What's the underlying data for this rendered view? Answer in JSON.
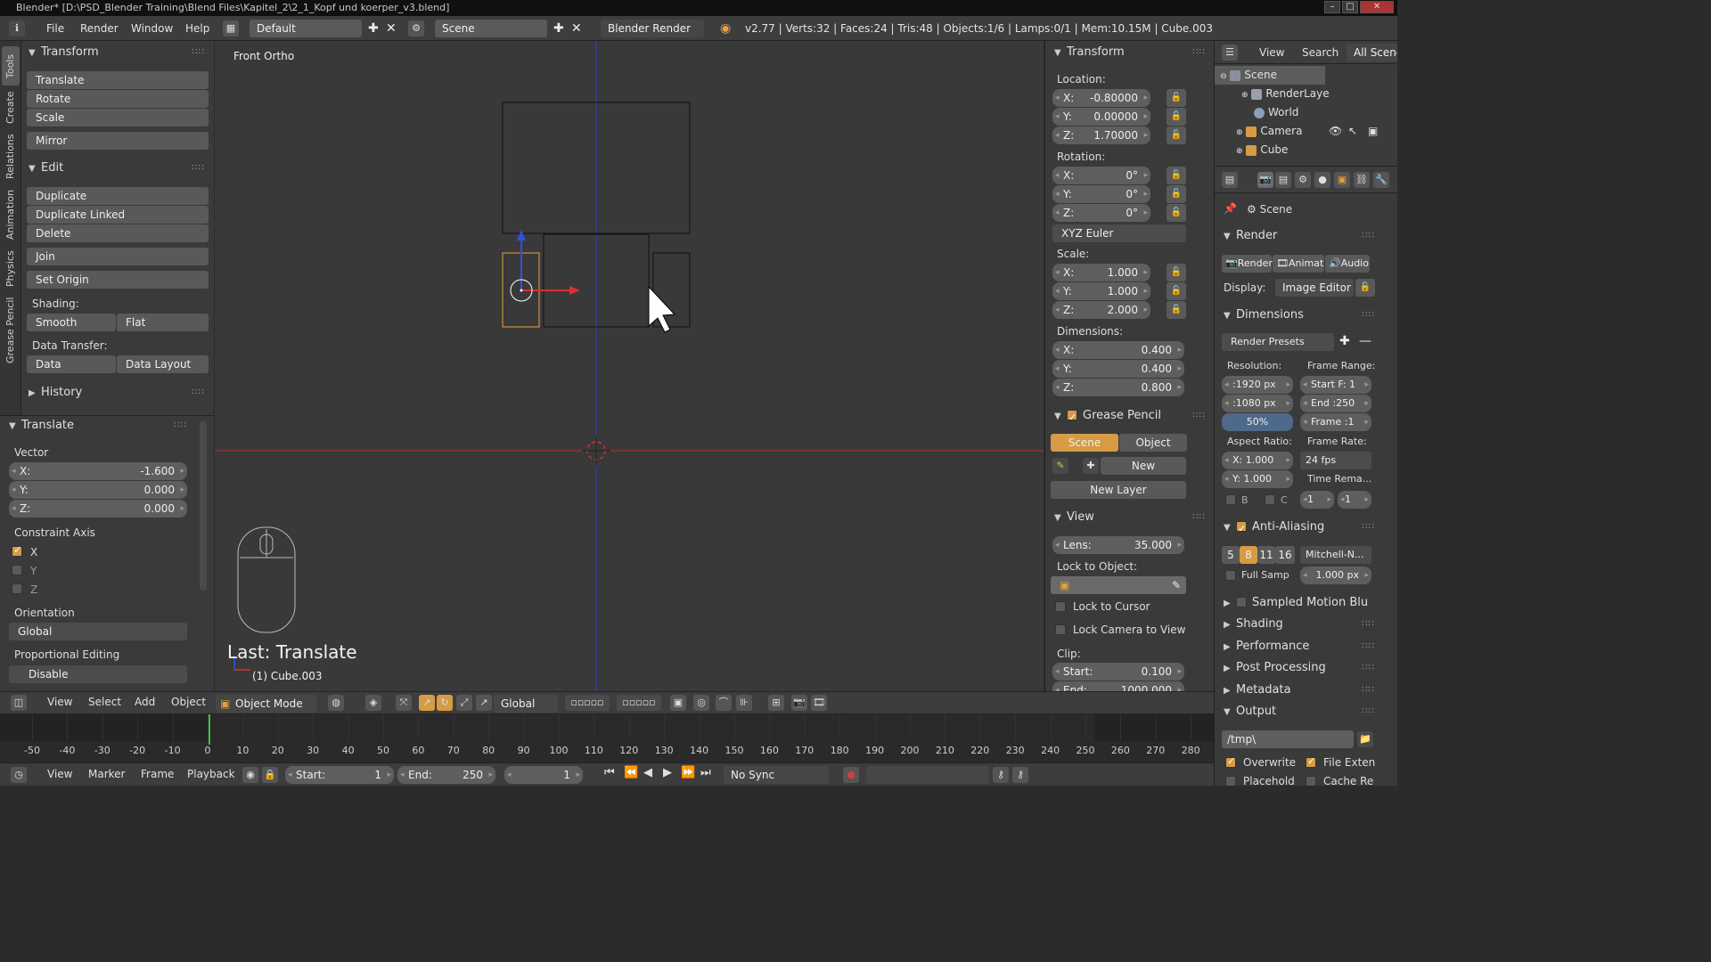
{
  "window": {
    "title": "Blender* [D:\\PSD_Blender Training\\Blend Files\\Kapitel_2\\2_1_Kopf und koerper_v3.blend]"
  },
  "topbar": {
    "menus": [
      "File",
      "Render",
      "Window",
      "Help"
    ],
    "layout": "Default",
    "scene": "Scene",
    "engine": "Blender Render",
    "stats": "v2.77 | Verts:32 | Faces:24 | Tris:48 | Objects:1/6 | Lamps:0/1 | Mem:10.15M | Cube.003"
  },
  "tabs": [
    "Tools",
    "Create",
    "Relations",
    "Animation",
    "Physics",
    "Grease Pencil"
  ],
  "toolshelf": {
    "transform": {
      "title": "Transform",
      "items": [
        "Translate",
        "Rotate",
        "Scale",
        "Mirror"
      ]
    },
    "edit": {
      "title": "Edit",
      "items": [
        "Duplicate",
        "Duplicate Linked",
        "Delete",
        "Join",
        "Set Origin"
      ]
    },
    "shading": {
      "label": "Shading:",
      "smooth": "Smooth",
      "flat": "Flat"
    },
    "datatransfer": {
      "label": "Data Transfer:",
      "data": "Data",
      "layout": "Data Layout"
    },
    "history": "History"
  },
  "operator": {
    "title": "Translate",
    "vector": "Vector",
    "x_label": "X:",
    "x": "-1.600",
    "y_label": "Y:",
    "y": "0.000",
    "z_label": "Z:",
    "z": "0.000",
    "constraint": "Constraint Axis",
    "cx": "X",
    "cy": "Y",
    "cz": "Z",
    "orientation": "Orientation",
    "orientation_value": "Global",
    "prop_edit": "Proportional Editing",
    "prop_value": "Disable"
  },
  "viewport": {
    "label": "Front Ortho",
    "last_op": "Last: Translate",
    "object": "(1) Cube.003"
  },
  "npanel": {
    "transform": "Transform",
    "location": "Location:",
    "loc": [
      "-0.80000",
      "0.00000",
      "1.70000"
    ],
    "rotation": "Rotation:",
    "rot": [
      "0°",
      "0°",
      "0°"
    ],
    "euler": "XYZ Euler",
    "scale": "Scale:",
    "scl": [
      "1.000",
      "1.000",
      "2.000"
    ],
    "dimensions": "Dimensions:",
    "dim": [
      "0.400",
      "0.400",
      "0.800"
    ],
    "axes": [
      "X:",
      "Y:",
      "Z:"
    ],
    "gp": "Grease Pencil",
    "gp_scene": "Scene",
    "gp_object": "Object",
    "gp_new": "New",
    "gp_newlayer": "New Layer",
    "view": "View",
    "lens_label": "Lens:",
    "lens": "35.000",
    "lock_obj": "Lock to Object:",
    "lock_cursor": "Lock to Cursor",
    "lock_camera": "Lock Camera to View",
    "clip": "Clip:",
    "clip_start_label": "Start:",
    "clip_start": "0.100",
    "clip_end_label": "End:",
    "clip_end": "1000.000"
  },
  "outliner": {
    "view": "View",
    "search": "Search",
    "filter": "All Scenes",
    "rows": [
      "Scene",
      "RenderLaye",
      "World",
      "Camera",
      "Cube"
    ]
  },
  "props": {
    "scene": "Scene",
    "render": "Render",
    "render_btn": "Render",
    "anim_btn": "Animat",
    "audio_btn": "Audio",
    "display_label": "Display:",
    "display": "Image Editor",
    "dimensions": "Dimensions",
    "presets": "Render Presets",
    "resolution": "Resolution:",
    "res_x": ":1920 px",
    "res_y": ":1080 px",
    "res_pct": "50%",
    "frame_range": "Frame Range:",
    "start": "Start F: 1",
    "end": "End :250",
    "frame": "Frame :1",
    "aspect": "Aspect Ratio:",
    "ax": "X:  1.000",
    "ay": "Y:  1.000",
    "frame_rate": "Frame Rate:",
    "fps": "24 fps",
    "time_rem": "Time Rema...",
    "b": "B",
    "c": "C",
    "one_a": "1",
    "one_b": "1",
    "aa": "Anti-Aliasing",
    "aa_opts": [
      "5",
      "8",
      "11",
      "16"
    ],
    "aa_filter": "Mitchell-N...",
    "full_samp": "Full Samp",
    "aa_px": "1.000 px",
    "smb": "Sampled Motion Blu",
    "shading": "Shading",
    "performance": "Performance",
    "post": "Post Processing",
    "metadata": "Metadata",
    "output": "Output",
    "path": "/tmp\\",
    "overwrite": "Overwrite",
    "file_ext": "File Exten",
    "placeholder": "Placehold",
    "cache": "Cache Re"
  },
  "vheader": {
    "view": "View",
    "select": "Select",
    "add": "Add",
    "object": "Object",
    "mode": "Object Mode",
    "orient": "Global"
  },
  "timeline": {
    "ticks": [
      "-50",
      "-40",
      "-30",
      "-20",
      "-10",
      "0",
      "10",
      "20",
      "30",
      "40",
      "50",
      "60",
      "70",
      "80",
      "90",
      "100",
      "110",
      "120",
      "130",
      "140",
      "150",
      "160",
      "170",
      "180",
      "190",
      "200",
      "210",
      "220",
      "230",
      "240",
      "250",
      "260",
      "270",
      "280"
    ]
  },
  "tlheader": {
    "view": "View",
    "marker": "Marker",
    "frame": "Frame",
    "playback": "Playback",
    "start": "Start:",
    "start_val": "1",
    "end": "End:",
    "end_val": "250",
    "cur": "1",
    "sync": "No Sync"
  },
  "colors": {
    "accent": "#d69b44",
    "selected_outline": "#f0a040",
    "x_axis": "#d63030",
    "z_axis": "#3050e0"
  }
}
